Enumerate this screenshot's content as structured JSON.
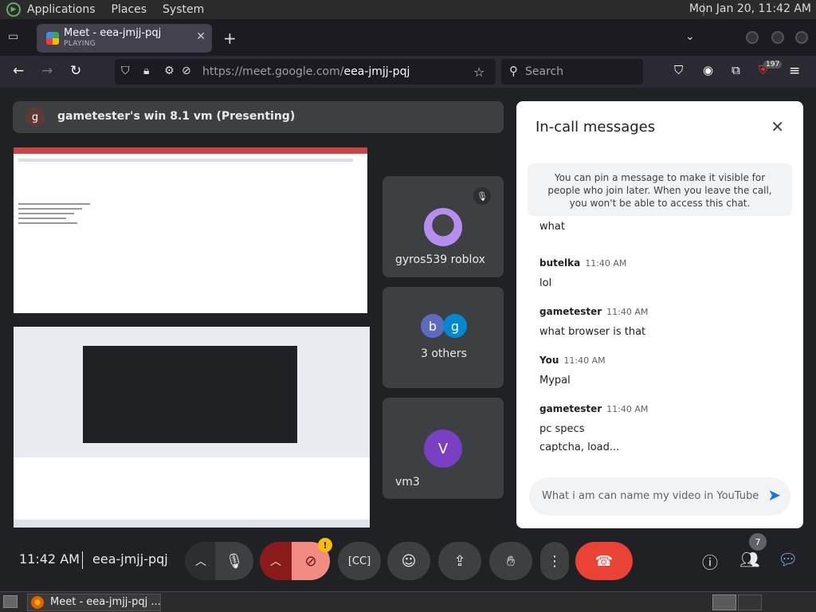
{
  "system": {
    "menus": [
      "Applications",
      "Places",
      "System"
    ],
    "clock": "Mon Jan 20, 11:42 AM"
  },
  "browser": {
    "tab_title": "Meet - eea-jmjj-pqj",
    "tab_status": "PLAYING",
    "url_host": "https://meet.google.com/",
    "url_path": "eea-jmjj-pqj",
    "search_placeholder": "Search",
    "extension_badge": "197"
  },
  "meet": {
    "presenter_initial": "g",
    "presenter_label": "gametester's win 8.1 vm (Presenting)",
    "participants": [
      {
        "name": "gyros539 roblox",
        "muted": true
      },
      {
        "name": "3 others",
        "initials": [
          "b",
          "g"
        ]
      },
      {
        "name": "vm3",
        "initial": "V"
      }
    ],
    "time": "11:42 AM",
    "meeting_code": "eea-jmjj-pqj",
    "people_count": "7",
    "camera_warning": "!"
  },
  "chat": {
    "title": "In-call messages",
    "notice": "You can pin a message to make it visible for people who join later. When you leave the call, you won't be able to access this chat.",
    "partial_message": "what",
    "messages": [
      {
        "sender": "butelka",
        "time": "11:40 AM",
        "lines": [
          "lol"
        ]
      },
      {
        "sender": "gametester",
        "time": "11:40 AM",
        "lines": [
          "what browser is that"
        ]
      },
      {
        "sender": "You",
        "time": "11:40 AM",
        "lines": [
          "Mypal"
        ]
      },
      {
        "sender": "gametester",
        "time": "11:40 AM",
        "lines": [
          "pc specs",
          "captcha, load..."
        ]
      }
    ],
    "compose_text": "What i am can name my video in YouTube"
  },
  "taskbar": {
    "window_title": "Meet - eea-jmjj-pqj ..."
  },
  "colors": {
    "meet_bg": "#202124",
    "tile_bg": "#3c4043",
    "hangup": "#ea4335",
    "accent_blue": "#1a73e8"
  }
}
